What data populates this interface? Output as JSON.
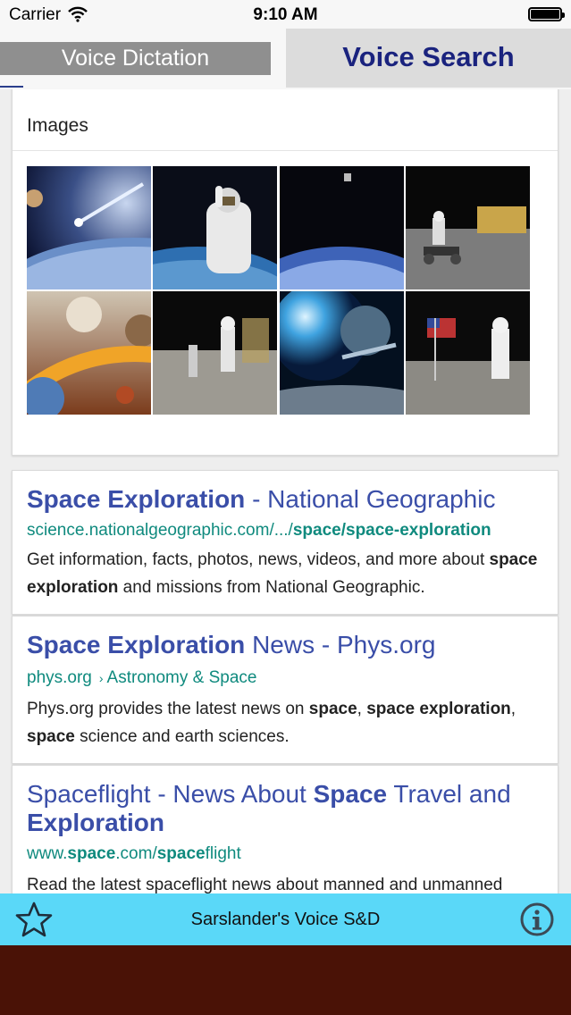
{
  "status_bar": {
    "carrier": "Carrier",
    "time": "9:10 AM"
  },
  "tabs": {
    "dictation_label": "Voice Dictation",
    "search_label": "Voice Search",
    "active": "Voice Search"
  },
  "images_section": {
    "title": "Images",
    "thumbnails": [
      "comet-over-planet",
      "astronaut-spacewalk",
      "astronaut-above-earth",
      "lunar-rover",
      "planets-and-rings",
      "astronaut-on-moon",
      "galaxy-and-planet",
      "astronaut-with-flag"
    ]
  },
  "results": [
    {
      "title_bold": "Space Exploration",
      "title_rest": " - National Geographic",
      "url_plain": "science.nationalgeographic.com/.../",
      "url_bold": "space/space-exploration",
      "snippet_pre": "Get information, facts, photos, news, videos, and more about ",
      "snippet_bold": "space exploration",
      "snippet_post": " and missions from National Geographic."
    },
    {
      "title_bold": "Space Exploration",
      "title_rest": " News - Phys.org",
      "url_plain": "phys.org",
      "url_sep": "›",
      "url_rest": "Astronomy & Space",
      "snippet_1": "Phys.org provides the latest news on ",
      "snippet_2": "space",
      "snippet_3": ", ",
      "snippet_4": "space exploration",
      "snippet_5": ", ",
      "snippet_6": "space",
      "snippet_7": " science and earth sciences."
    },
    {
      "title_1": "Spaceflight - News About ",
      "title_2": "Space",
      "title_3": " Travel and ",
      "title_4": "Exploration",
      "url_1": "www.",
      "url_2": "space",
      "url_3": ".com/",
      "url_4": "space",
      "url_5": "flight",
      "snippet": "Read the latest spaceflight news about manned and unmanned"
    }
  ],
  "footer": {
    "title": "Sarslander's Voice S&D"
  },
  "colors": {
    "tab_active_text": "#1a237e",
    "result_title": "#3a4ea8",
    "result_url": "#0f8a7e",
    "footer_bg": "#5ad8f8",
    "bottom_bg": "#4a1206"
  }
}
